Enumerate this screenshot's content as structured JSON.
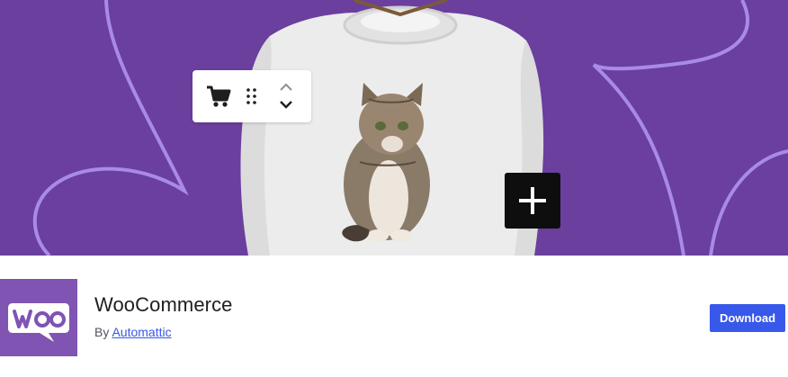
{
  "banner": {
    "background_color": "#6a3f9e",
    "swirl_color": "#a98ae6",
    "image_description_icon": "sweater-with-kitten-image",
    "toolbar": {
      "cart_icon": "cart-icon",
      "drag_icon": "drag-handle-icon",
      "up_icon": "chevron-up-icon",
      "down_icon": "chevron-down-icon"
    },
    "add_icon": "plus-icon"
  },
  "plugin": {
    "logo_text": "Woo",
    "logo_color": "#7f54b3",
    "name": "WooCommerce",
    "by_prefix": "By",
    "author": "Automattic",
    "download_label": "Download",
    "accent_color": "#3858e9"
  }
}
